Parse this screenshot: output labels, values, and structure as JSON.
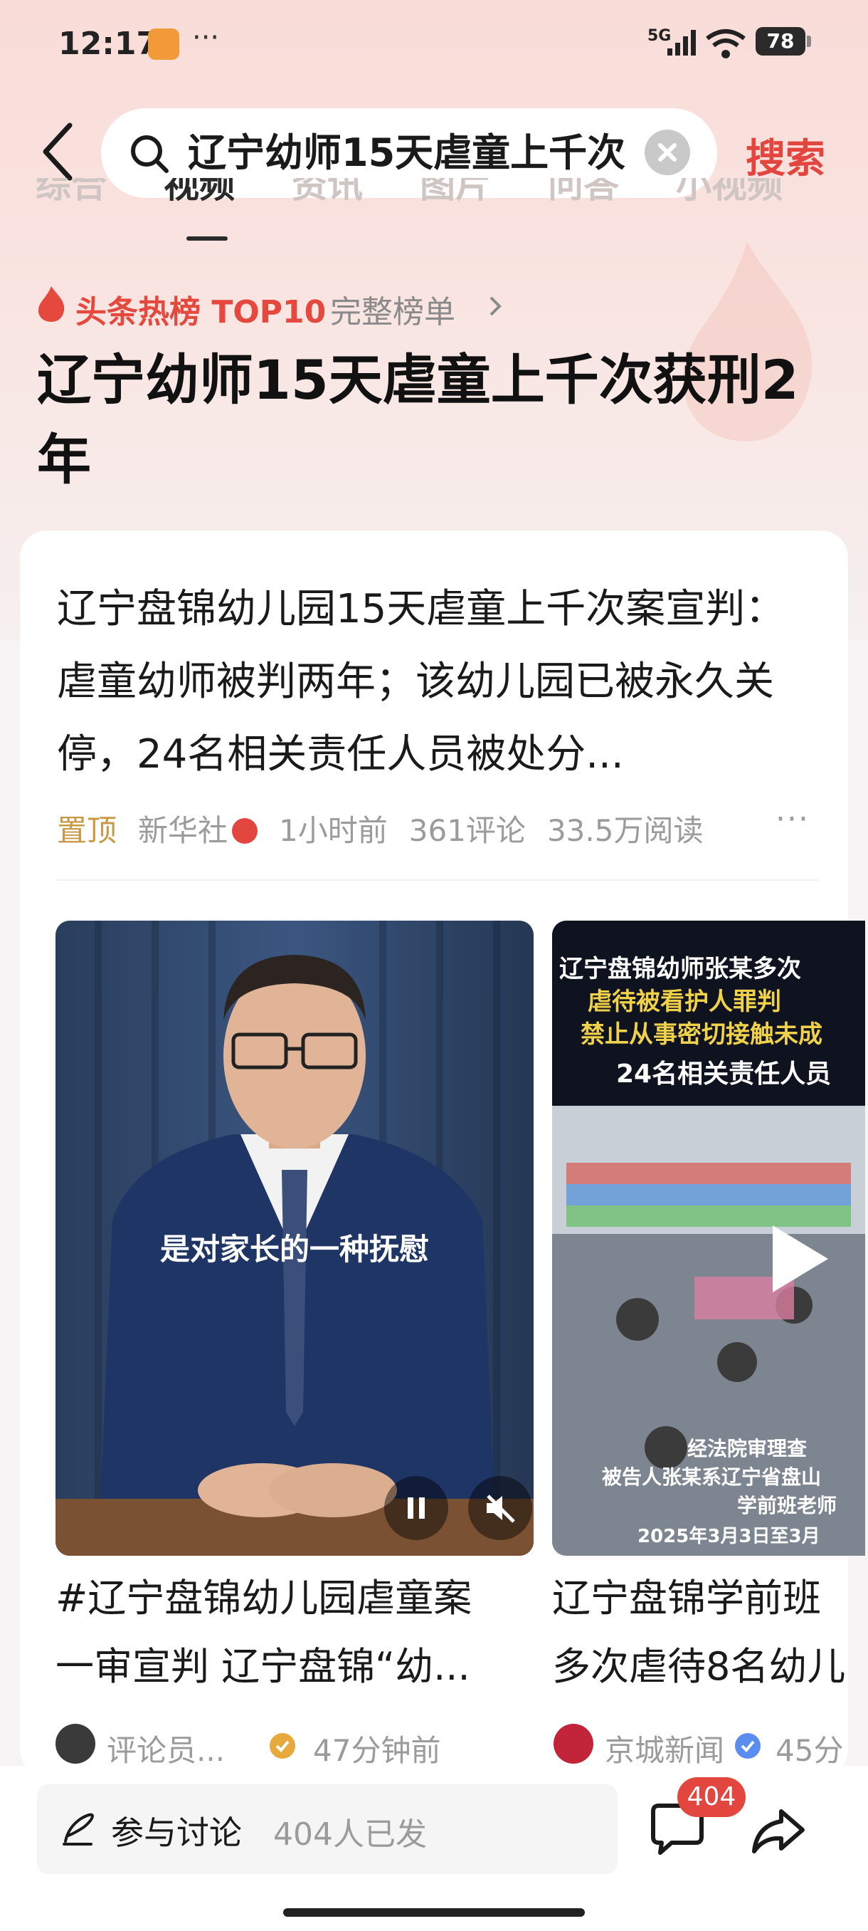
{
  "status_bar": {
    "time": "12:17",
    "dots": "···",
    "network": "5G",
    "battery": "78"
  },
  "search": {
    "query": "辽宁幼师15天虐童上千次",
    "button": "搜索"
  },
  "tabs": [
    "综合",
    "视频",
    "资讯",
    "图片",
    "问答",
    "小视频"
  ],
  "hot_list": {
    "label": "头条热榜 TOP10",
    "full_list": "完整榜单"
  },
  "headline": "辽宁幼师15天虐童上千次获刑2年",
  "article": {
    "title": "辽宁盘锦幼儿园15天虐童上千次案宣判：虐童幼师被判两年；该幼儿园已被永久关停，24名相关责任人员被处分...",
    "pinned": "置顶",
    "source": "新华社",
    "time": "1小时前",
    "comments": "361评论",
    "reads": "33.5万阅读",
    "more": "···"
  },
  "videos": [
    {
      "caption": "是对家长的一种抚慰",
      "title_line1": "#辽宁盘锦幼儿园虐童案",
      "title_line2": "一审宣判 辽宁盘锦“幼...",
      "author": "评论员...",
      "time": "47分钟前"
    },
    {
      "banner_lines": [
        "辽宁盘锦幼师张某多次",
        "虐待被看护人罪判",
        "禁止从事密切接触未成",
        "24名相关责任人员"
      ],
      "footer_lines": [
        "经法院审理查",
        "被告人张某系辽宁省盘山",
        "学前班老师",
        "2025年3月3日至3月"
      ],
      "title_line1": "辽宁盘锦学前班",
      "title_line2": "多次虐待8名幼儿",
      "author": "京城新闻",
      "time": "45分"
    }
  ],
  "bottom_bar": {
    "discuss": "参与讨论",
    "count": "404人已发",
    "badge": "404"
  },
  "colors": {
    "accent": "#e2463e",
    "pinned": "#c99a46",
    "verified": "#5b8cf0"
  }
}
